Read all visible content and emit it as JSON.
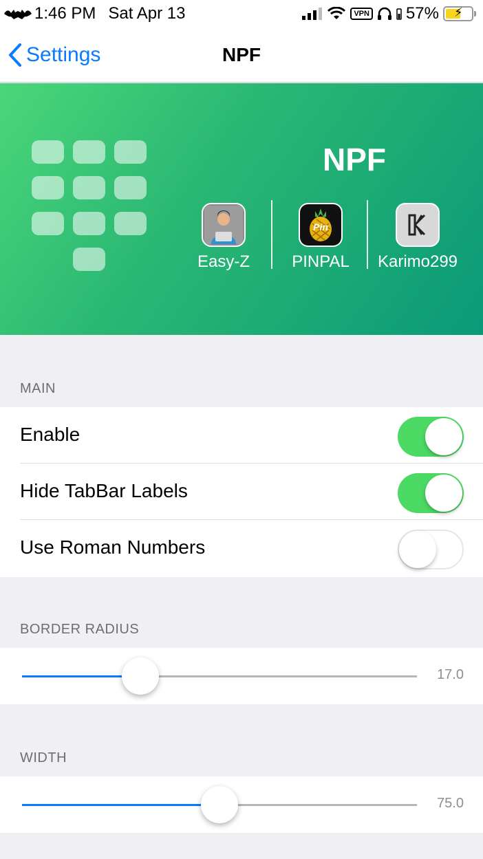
{
  "status_bar": {
    "carrier_icon": "bat-icon",
    "time": "1:46 PM",
    "date": "Sat Apr 13",
    "vpn": "VPN",
    "battery": "57%"
  },
  "nav": {
    "back_label": "Settings",
    "title": "NPF"
  },
  "banner": {
    "title": "NPF",
    "credits": [
      {
        "name": "Easy-Z",
        "icon": "developer-avatar-icon"
      },
      {
        "name": "PINPAL",
        "icon": "pineapple-pin-icon"
      },
      {
        "name": "Karimo299",
        "icon": "k-logo-icon"
      }
    ]
  },
  "sections": {
    "main": {
      "header": "MAIN",
      "rows": [
        {
          "label": "Enable",
          "on": true
        },
        {
          "label": "Hide TabBar Labels",
          "on": true
        },
        {
          "label": "Use Roman Numbers",
          "on": false
        }
      ]
    },
    "border_radius": {
      "header": "BORDER RADIUS",
      "value": "17.0",
      "fraction": 0.3
    },
    "width": {
      "header": "WIDTH",
      "value": "75.0",
      "fraction": 0.5
    }
  },
  "colors": {
    "accent": "#0a7aff",
    "toggle_on": "#4cd964",
    "banner_start": "#4bd67a",
    "banner_end": "#0a9a78"
  }
}
